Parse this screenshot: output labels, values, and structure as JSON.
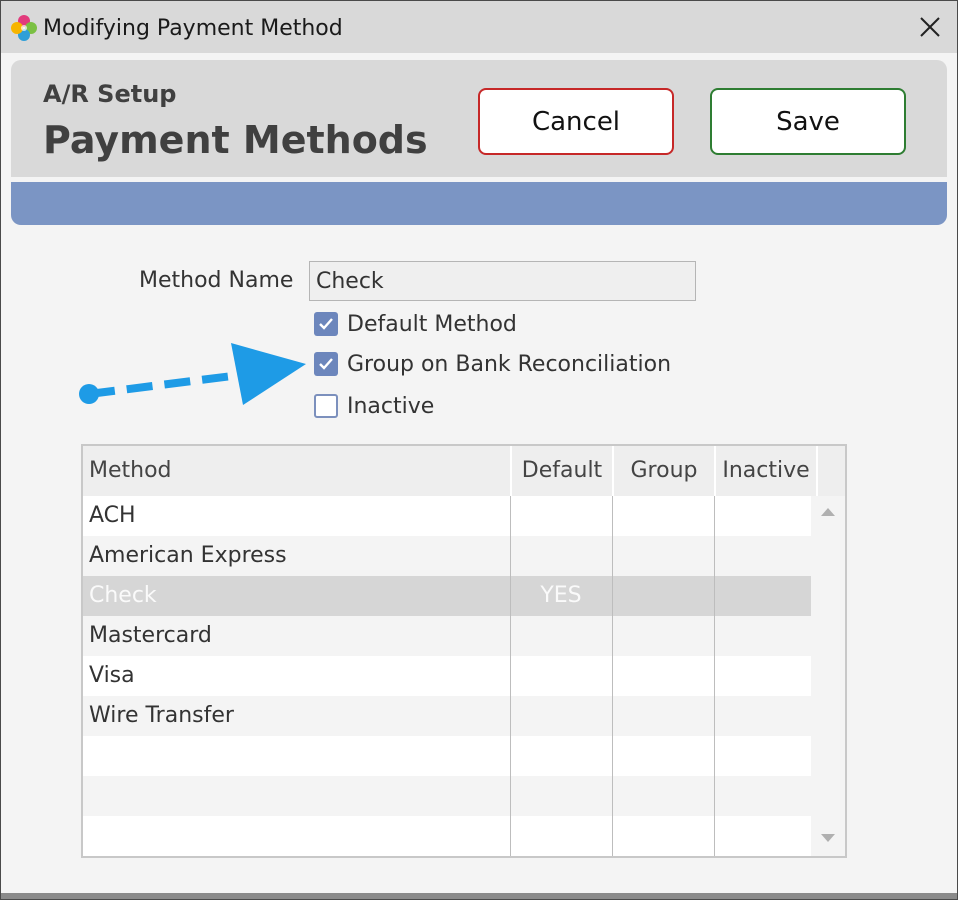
{
  "window": {
    "title": "Modifying Payment Method",
    "app_icon": "pinwheel-logo-icon",
    "close_icon": "close-x-icon"
  },
  "header": {
    "subtitle": "A/R Setup",
    "title": "Payment Methods",
    "cancel_label": "Cancel",
    "save_label": "Save",
    "cancel_color": "#c62828",
    "save_color": "#2e7d32",
    "band_color": "#7b95c4"
  },
  "form": {
    "method_name_label": "Method Name",
    "method_name_value": "Check",
    "checkboxes": [
      {
        "label": "Default Method",
        "checked": true
      },
      {
        "label": "Group on Bank Reconciliation",
        "checked": true
      },
      {
        "label": "Inactive",
        "checked": false
      }
    ]
  },
  "annotation": {
    "arrow_icon": "dashed-arrow-icon",
    "color": "#1e9be6"
  },
  "grid": {
    "columns": [
      "Method",
      "Default",
      "Group",
      "Inactive"
    ],
    "rows": [
      {
        "method": "ACH",
        "default": "",
        "group": "",
        "inactive": ""
      },
      {
        "method": "American Express",
        "default": "",
        "group": "",
        "inactive": ""
      },
      {
        "method": "Check",
        "default": "YES",
        "group": "",
        "inactive": "",
        "selected": true
      },
      {
        "method": "Mastercard",
        "default": "",
        "group": "",
        "inactive": ""
      },
      {
        "method": "Visa",
        "default": "",
        "group": "",
        "inactive": ""
      },
      {
        "method": "Wire Transfer",
        "default": "",
        "group": "",
        "inactive": ""
      }
    ]
  }
}
